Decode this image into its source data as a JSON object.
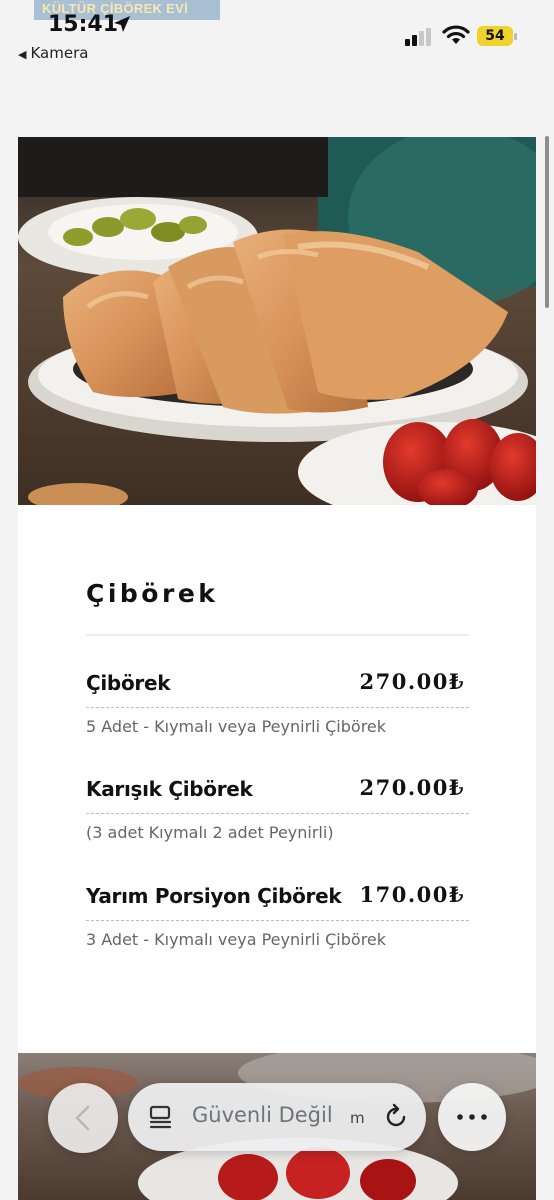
{
  "top_tag": "KÜLTÜR ÇİBÖREK EVİ",
  "status_bar": {
    "time": "15:41",
    "back_app": "Kamera",
    "battery": "54",
    "icons": [
      "location-arrow-icon",
      "signal-icon",
      "wifi-icon",
      "battery-icon"
    ]
  },
  "menu": {
    "section_title": "Çibörek",
    "items": [
      {
        "name": "Çibörek",
        "price": "270.00₺",
        "description": "5 Adet - Kıymalı veya Peynirli Çibörek"
      },
      {
        "name": "Karışık Çibörek",
        "price": "270.00₺",
        "description": "(3 adet Kıymalı 2 adet Peynirli)"
      },
      {
        "name": "Yarım Porsiyon Çibörek",
        "price": "170.00₺",
        "description": "3 Adet - Kıymalı veya Peynirli Çibörek"
      }
    ]
  },
  "browser_bar": {
    "url_text": "Güvenli Değil",
    "url_tail": "m",
    "icons": [
      "back-chevron-icon",
      "reader-icon",
      "reload-icon",
      "more-icon"
    ]
  },
  "colors": {
    "battery_fill": "#f0d22c",
    "tag_bg": "#a9bfd3",
    "card_bg": "#ffffff",
    "page_bg": "#f3f3f3",
    "desc_text": "#666666"
  }
}
